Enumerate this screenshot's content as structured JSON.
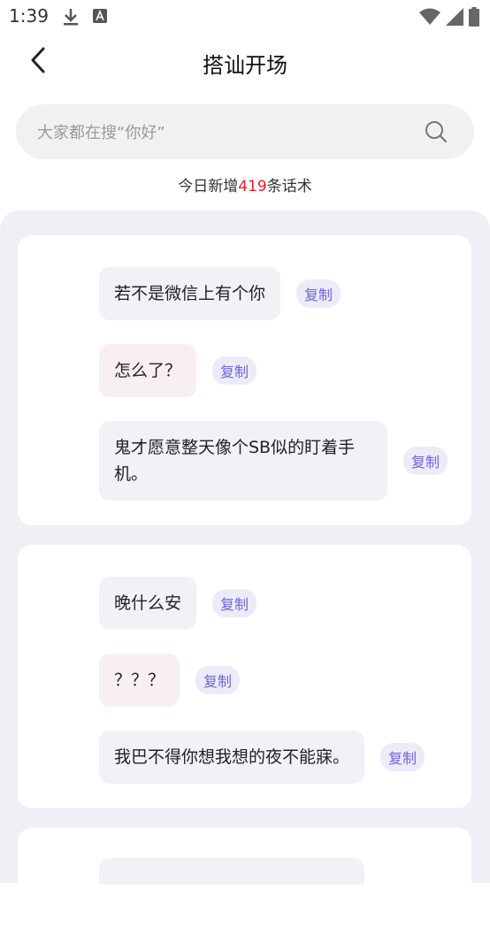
{
  "status_bar": {
    "time": "1:39"
  },
  "header": {
    "title": "搭讪开场"
  },
  "search": {
    "placeholder": "大家都在搜“你好”"
  },
  "daily": {
    "prefix": "今日新增",
    "count": "419",
    "suffix": "条话术"
  },
  "copy_label": "复制",
  "cards": [
    {
      "messages": [
        {
          "text": "若不是微信上有个你"
        },
        {
          "text": "怎么了？"
        },
        {
          "text": "鬼才愿意整天像个SB似的盯着手机。"
        }
      ]
    },
    {
      "messages": [
        {
          "text": "晚什么安"
        },
        {
          "text": "？？？"
        },
        {
          "text": "我巴不得你想我想的夜不能寐。"
        }
      ]
    }
  ],
  "colors": {
    "accent": "#6e66d8",
    "copy_bg": "#ecebf8",
    "count_red": "#e02020",
    "bubble_gray": "#f1f1f6",
    "bubble_pink": "#f8eff3",
    "list_bg": "#efeff5"
  },
  "icons": [
    "download-icon",
    "font-app-icon",
    "wifi-icon",
    "signal-icon",
    "battery-icon",
    "back-arrow-icon",
    "search-icon"
  ]
}
